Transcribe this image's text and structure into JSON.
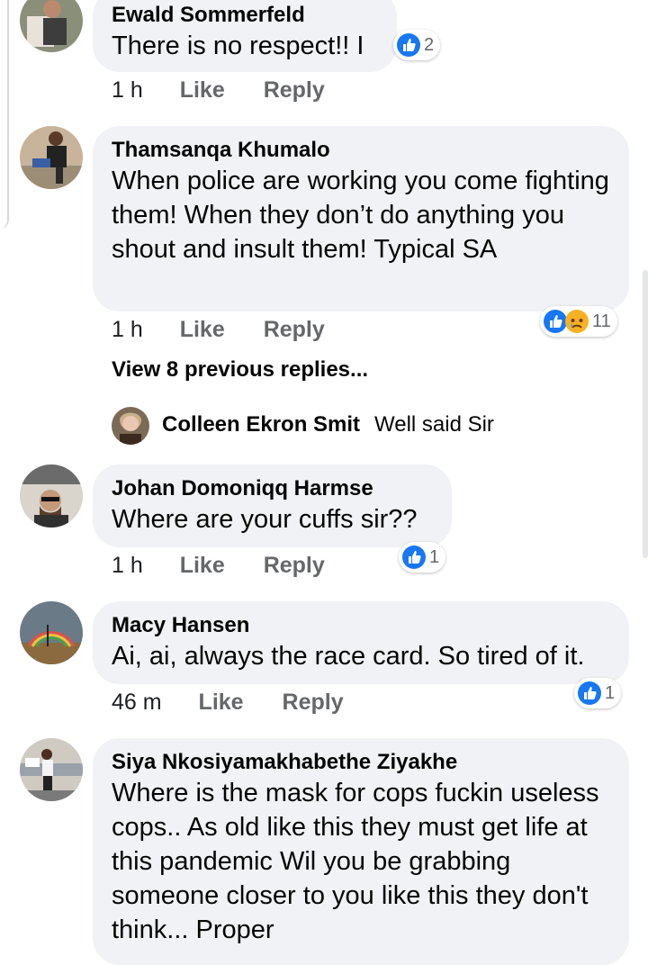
{
  "actions": {
    "like": "Like",
    "reply": "Reply"
  },
  "comments": [
    {
      "author": "Ewald Sommerfeld",
      "text": "There is no respect!! I",
      "time": "1 h",
      "reactions": {
        "types": [
          "like-icon"
        ],
        "count": "2"
      }
    },
    {
      "author": "Thamsanqa Khumalo",
      "text": "When police are working you come fighting them! When they don’t do anything you shout and insult them! Typical SA",
      "time": "1 h",
      "reactions": {
        "types": [
          "like-icon",
          "sad-icon"
        ],
        "count": "11"
      },
      "view_previous": "View 8 previous replies...",
      "latest_reply": {
        "author": "Colleen Ekron Smit",
        "text": "Well said Sir"
      }
    },
    {
      "author": "Johan Domoniqq Harmse",
      "text": "Where are your cuffs sir??",
      "time": "1 h",
      "reactions": {
        "types": [
          "like-icon"
        ],
        "count": "1"
      }
    },
    {
      "author": "Macy Hansen",
      "text": "Ai, ai, always the race card.  So tired of it.",
      "time": "46 m",
      "reactions": {
        "types": [
          "like-icon"
        ],
        "count": "1"
      }
    },
    {
      "author": "Siya Nkosiyamakhabethe Ziyakhe",
      "text": "Where is the mask for cops fuckin useless cops.. As old like this they must get life at this pandemic Wil you be grabbing someone closer to you like this they don't think... Proper"
    }
  ],
  "colors": {
    "bubble": "#f0f2f5",
    "like_blue": "#1877f2",
    "meta_gray": "#65676b",
    "sad_yellow": "#f7b125"
  }
}
